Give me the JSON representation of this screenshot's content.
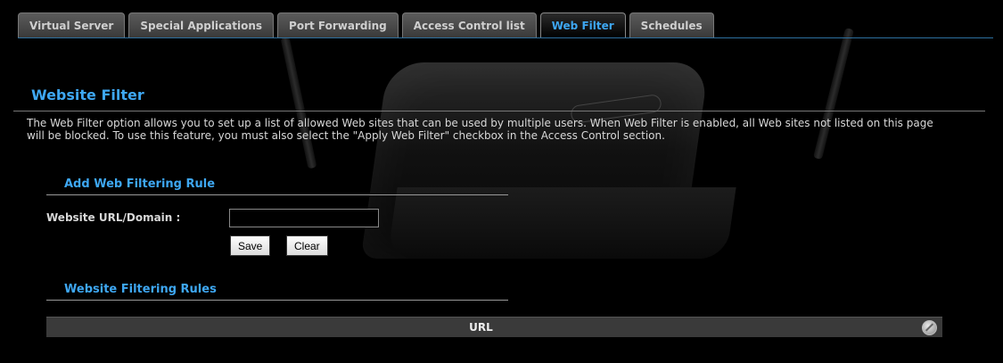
{
  "tabs": [
    {
      "label": "Virtual Server",
      "active": false
    },
    {
      "label": "Special Applications",
      "active": false
    },
    {
      "label": "Port Forwarding",
      "active": false
    },
    {
      "label": "Access Control list",
      "active": false
    },
    {
      "label": "Web Filter",
      "active": true
    },
    {
      "label": "Schedules",
      "active": false
    }
  ],
  "page": {
    "title": "Website Filter",
    "description": "The Web Filter option allows you to set up a list of allowed Web sites that can be used by multiple users. When Web Filter is enabled, all Web sites not listed on this page will be blocked. To use this feature, you must also select the \"Apply Web Filter\" checkbox in the Access Control section."
  },
  "add_rule": {
    "heading": "Add Web Filtering Rule",
    "url_label": "Website URL/Domain :",
    "url_value": "",
    "save_label": "Save",
    "clear_label": "Clear"
  },
  "rules": {
    "heading": "Website Filtering Rules",
    "column_url": "URL",
    "action_icon": "disabled-circle-icon"
  },
  "colors": {
    "accent": "#3ea7f2",
    "background": "#000000"
  }
}
